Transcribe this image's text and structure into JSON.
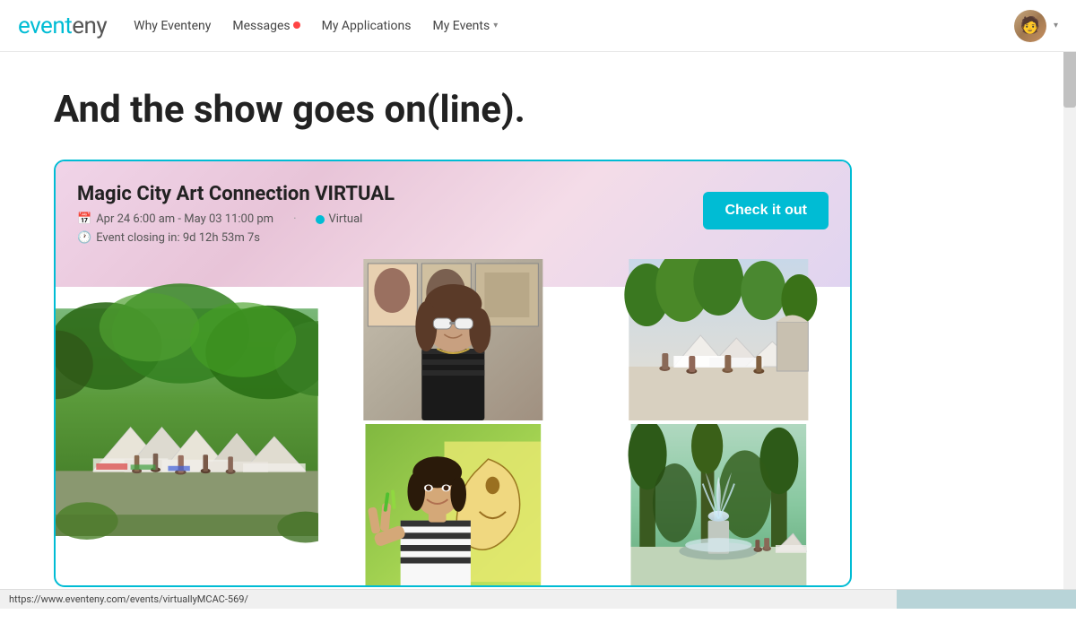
{
  "navbar": {
    "logo": {
      "event_part": "event",
      "eny_part": "eny"
    },
    "links": [
      {
        "id": "why-eventeny",
        "label": "Why Eventeny",
        "has_dot": false,
        "has_dropdown": false
      },
      {
        "id": "messages",
        "label": "Messages",
        "has_dot": true,
        "has_dropdown": false
      },
      {
        "id": "my-applications",
        "label": "My Applications",
        "has_dot": false,
        "has_dropdown": false
      },
      {
        "id": "my-events",
        "label": "My Events",
        "has_dot": false,
        "has_dropdown": true
      }
    ]
  },
  "hero": {
    "title": "And the show goes on(line)."
  },
  "event_card": {
    "title": "Magic City Art Connection VIRTUAL",
    "date_range": "Apr 24 6:00 am - May 03 11:00 pm",
    "location_type": "Virtual",
    "closing_text": "Event closing in: 9d 12h 53m 7s",
    "cta_button": "Check it out"
  },
  "status_bar": {
    "url": "https://www.eventeny.com/events/virtuallyMCAC-569/"
  },
  "icons": {
    "calendar": "📅",
    "clock": "🕐",
    "chevron_down": "▾",
    "virtual_pin": "📍"
  }
}
